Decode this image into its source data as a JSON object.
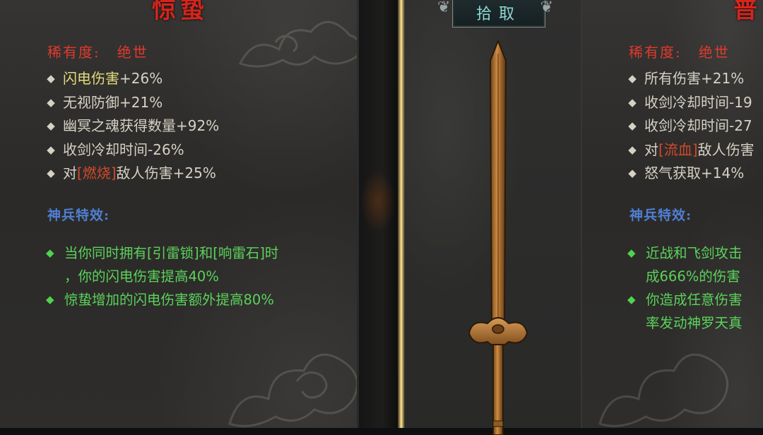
{
  "left_panel": {
    "item_name": "惊蛰",
    "rarity": {
      "label": "稀有度:",
      "value": "绝世"
    },
    "stats": [
      {
        "highlight": "闪电伤害",
        "rest": "+26%"
      },
      {
        "text": "无视防御+21%"
      },
      {
        "text": "幽冥之魂获得数量+92%"
      },
      {
        "text": "收剑冷却时间-26%"
      },
      {
        "pre": "对",
        "tag": "[燃烧]",
        "post": "敌人伤害+25%"
      }
    ],
    "effects_title": "神兵特效:",
    "effects": [
      {
        "line1": "当你同时拥有[引雷锁]和[响雷石]时",
        "line2": "，你的闪电伤害提高40%"
      },
      {
        "line1": "惊蛰增加的闪电伤害额外提高80%"
      }
    ]
  },
  "pickup_button": {
    "label": "拾取"
  },
  "right_panel": {
    "item_name": "普",
    "rarity": {
      "label": "稀有度:",
      "value": "绝世"
    },
    "stats": [
      {
        "text": "所有伤害+21%"
      },
      {
        "text": "收剑冷却时间-19"
      },
      {
        "text": "收剑冷却时间-27"
      },
      {
        "pre": "对",
        "tag": "[流血]",
        "post": "敌人伤害"
      },
      {
        "text": "怒气获取+14%"
      }
    ],
    "effects_title": "神兵特效:",
    "effects": [
      {
        "line1": "近战和飞剑攻击",
        "line2": "成666%的伤害"
      },
      {
        "line1": "你造成任意伤害",
        "line2": "率发动神罗天真"
      }
    ]
  },
  "icons": [
    "diamond-bullet-icon",
    "green-diamond-icon",
    "sword-icon",
    "scroll-ornament-icon"
  ],
  "colors": {
    "name_red": "#d4251d",
    "stat_text": "#d6d1c5",
    "highlight_yellow": "#e3dc7c",
    "effect_green": "#5bd25b",
    "title_blue": "#4f7fd4",
    "pickup_cyan": "#8fd6d4",
    "gold_line": "#f6e7a4"
  }
}
